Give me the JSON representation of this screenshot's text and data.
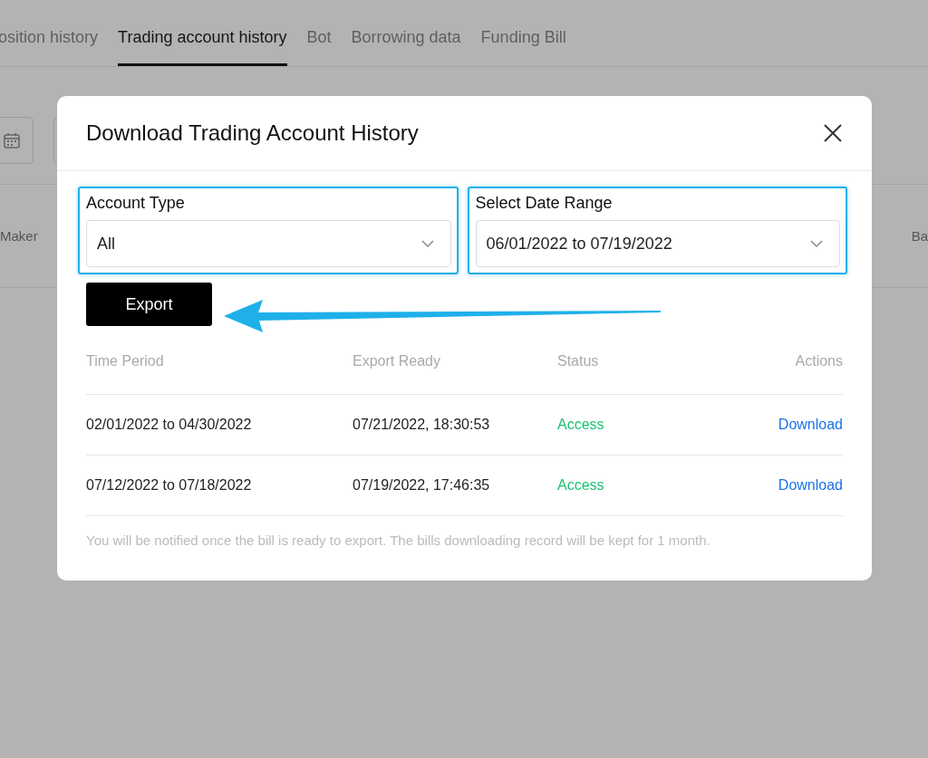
{
  "page_tabs": [
    {
      "label": "osition history",
      "selected": false
    },
    {
      "label": "Trading account history",
      "selected": true
    },
    {
      "label": "Bot",
      "selected": false
    },
    {
      "label": "Borrowing data",
      "selected": false
    },
    {
      "label": "Funding Bill",
      "selected": false
    }
  ],
  "background_table": {
    "columns": [
      "Maker",
      "Ba"
    ]
  },
  "dialog": {
    "title": "Download Trading Account History",
    "fields": [
      {
        "label": "Account Type",
        "value": "All"
      },
      {
        "label": "Select Date Range",
        "value": "06/01/2022 to 07/19/2022"
      }
    ],
    "export_button": "Export",
    "table": {
      "columns": [
        "Time Period",
        "Export Ready",
        "Status",
        "Actions"
      ],
      "rows": [
        {
          "time_period": "02/01/2022 to 04/30/2022",
          "export_ready": "07/21/2022, 18:30:53",
          "status": "Access",
          "action": "Download"
        },
        {
          "time_period": "07/12/2022 to 07/18/2022",
          "export_ready": "07/19/2022, 17:46:35",
          "status": "Access",
          "action": "Download"
        }
      ]
    },
    "note": "You will be notified once the bill is ready to export. The bills downloading record will be kept for 1 month."
  }
}
